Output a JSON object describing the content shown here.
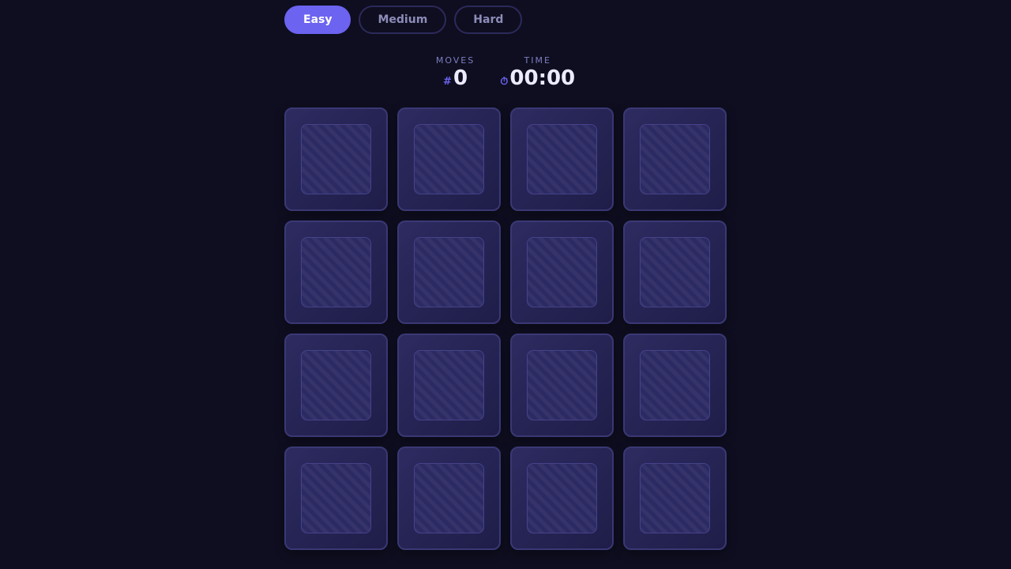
{
  "difficulty": {
    "options": [
      {
        "label": "Easy",
        "active": true
      },
      {
        "label": "Medium",
        "active": false
      },
      {
        "label": "Hard",
        "active": false
      }
    ]
  },
  "stats": {
    "moves": {
      "label": "MOVES",
      "icon": "hash-icon",
      "icon_glyph": "#",
      "value": "0"
    },
    "time": {
      "label": "TIME",
      "icon": "stopwatch-icon",
      "icon_glyph": "⏱",
      "value": "00:00"
    }
  },
  "board": {
    "rows": 4,
    "cols": 4,
    "cards_face_down": 16
  },
  "colors": {
    "background": "#0e0e20",
    "accent": "#6c63f0",
    "card": "#2d2b60"
  }
}
